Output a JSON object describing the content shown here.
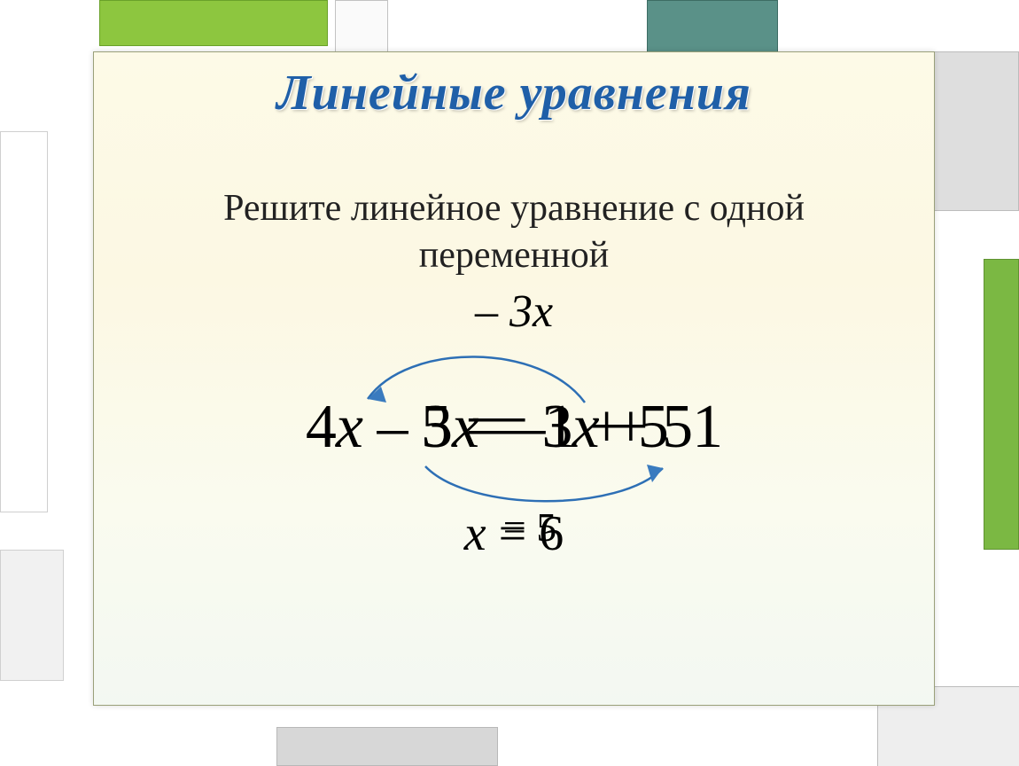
{
  "title": "Линейные уравнения",
  "subtitle_line1": "Решите линейное уравнение с одной",
  "subtitle_line2": "переменной",
  "math": {
    "top_expr": "– 3x",
    "main_layer_a": "4x – 3x = 3x + 51",
    "main_layer_b": "5 = –1 + 5",
    "bottom_layer_a": "x = 6",
    "bottom_layer_b": "= 5"
  },
  "colors": {
    "title": "#1f5fa8",
    "arrow": "#3a7bbf",
    "arc": "#2d6fb5"
  }
}
